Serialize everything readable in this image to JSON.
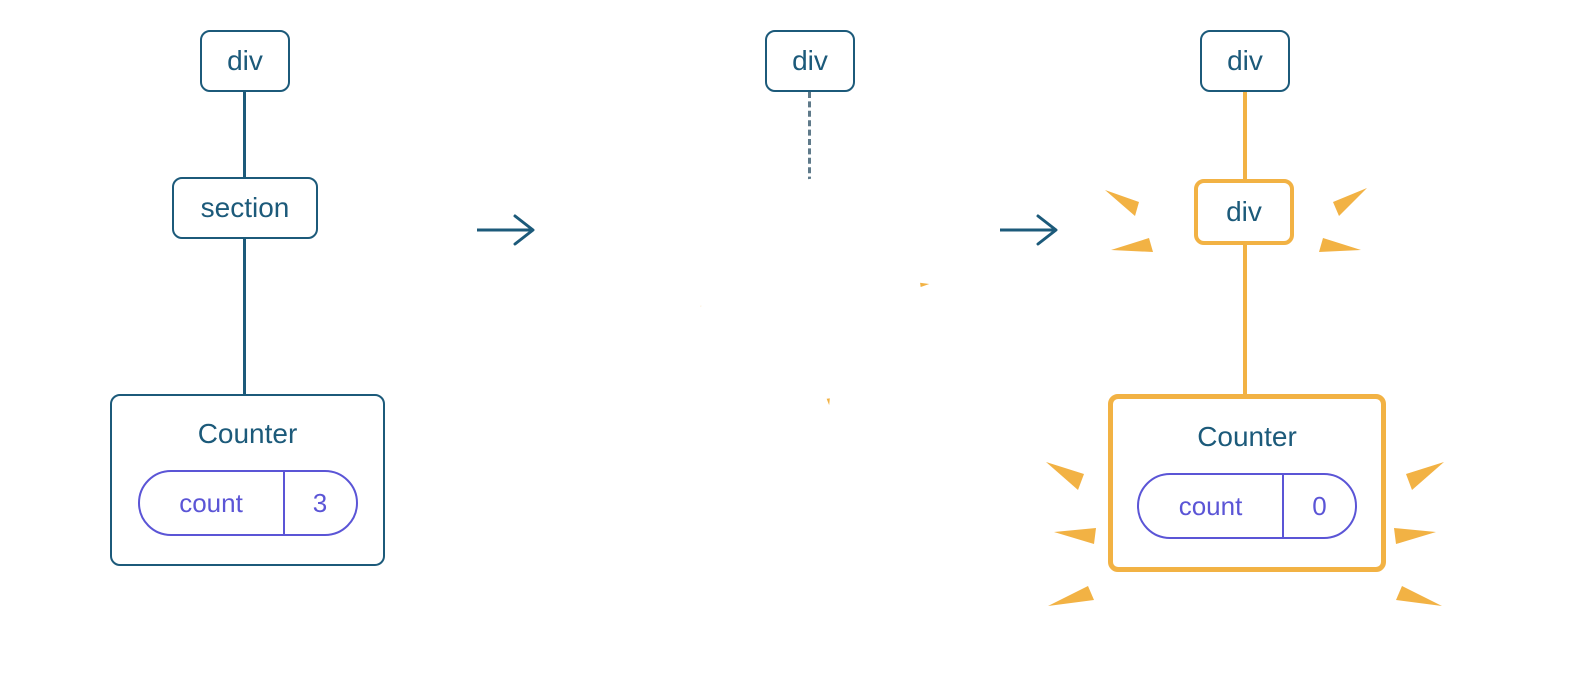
{
  "left": {
    "root": "div",
    "middle": "section",
    "counterTitle": "Counter",
    "countLabel": "count",
    "countValue": "3"
  },
  "middle": {
    "root": "div"
  },
  "right": {
    "root": "div",
    "middle": "div",
    "counterTitle": "Counter",
    "countLabel": "count",
    "countValue": "0"
  }
}
